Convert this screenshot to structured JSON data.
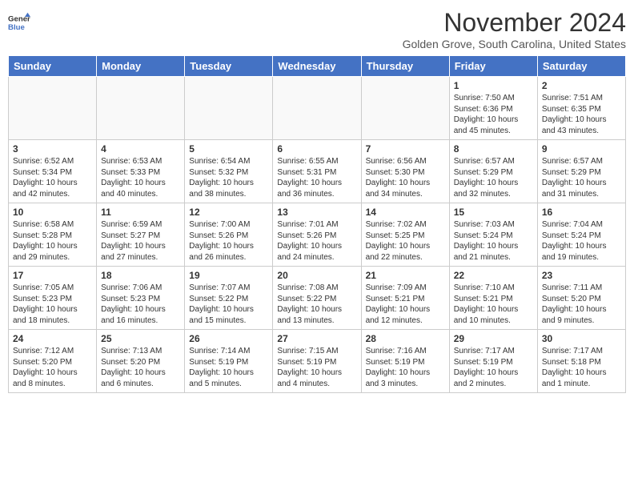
{
  "header": {
    "logo_line1": "General",
    "logo_line2": "Blue",
    "month": "November 2024",
    "location": "Golden Grove, South Carolina, United States"
  },
  "weekdays": [
    "Sunday",
    "Monday",
    "Tuesday",
    "Wednesday",
    "Thursday",
    "Friday",
    "Saturday"
  ],
  "weeks": [
    [
      {
        "day": "",
        "info": ""
      },
      {
        "day": "",
        "info": ""
      },
      {
        "day": "",
        "info": ""
      },
      {
        "day": "",
        "info": ""
      },
      {
        "day": "",
        "info": ""
      },
      {
        "day": "1",
        "info": "Sunrise: 7:50 AM\nSunset: 6:36 PM\nDaylight: 10 hours and 45 minutes."
      },
      {
        "day": "2",
        "info": "Sunrise: 7:51 AM\nSunset: 6:35 PM\nDaylight: 10 hours and 43 minutes."
      }
    ],
    [
      {
        "day": "3",
        "info": "Sunrise: 6:52 AM\nSunset: 5:34 PM\nDaylight: 10 hours and 42 minutes."
      },
      {
        "day": "4",
        "info": "Sunrise: 6:53 AM\nSunset: 5:33 PM\nDaylight: 10 hours and 40 minutes."
      },
      {
        "day": "5",
        "info": "Sunrise: 6:54 AM\nSunset: 5:32 PM\nDaylight: 10 hours and 38 minutes."
      },
      {
        "day": "6",
        "info": "Sunrise: 6:55 AM\nSunset: 5:31 PM\nDaylight: 10 hours and 36 minutes."
      },
      {
        "day": "7",
        "info": "Sunrise: 6:56 AM\nSunset: 5:30 PM\nDaylight: 10 hours and 34 minutes."
      },
      {
        "day": "8",
        "info": "Sunrise: 6:57 AM\nSunset: 5:29 PM\nDaylight: 10 hours and 32 minutes."
      },
      {
        "day": "9",
        "info": "Sunrise: 6:57 AM\nSunset: 5:29 PM\nDaylight: 10 hours and 31 minutes."
      }
    ],
    [
      {
        "day": "10",
        "info": "Sunrise: 6:58 AM\nSunset: 5:28 PM\nDaylight: 10 hours and 29 minutes."
      },
      {
        "day": "11",
        "info": "Sunrise: 6:59 AM\nSunset: 5:27 PM\nDaylight: 10 hours and 27 minutes."
      },
      {
        "day": "12",
        "info": "Sunrise: 7:00 AM\nSunset: 5:26 PM\nDaylight: 10 hours and 26 minutes."
      },
      {
        "day": "13",
        "info": "Sunrise: 7:01 AM\nSunset: 5:26 PM\nDaylight: 10 hours and 24 minutes."
      },
      {
        "day": "14",
        "info": "Sunrise: 7:02 AM\nSunset: 5:25 PM\nDaylight: 10 hours and 22 minutes."
      },
      {
        "day": "15",
        "info": "Sunrise: 7:03 AM\nSunset: 5:24 PM\nDaylight: 10 hours and 21 minutes."
      },
      {
        "day": "16",
        "info": "Sunrise: 7:04 AM\nSunset: 5:24 PM\nDaylight: 10 hours and 19 minutes."
      }
    ],
    [
      {
        "day": "17",
        "info": "Sunrise: 7:05 AM\nSunset: 5:23 PM\nDaylight: 10 hours and 18 minutes."
      },
      {
        "day": "18",
        "info": "Sunrise: 7:06 AM\nSunset: 5:23 PM\nDaylight: 10 hours and 16 minutes."
      },
      {
        "day": "19",
        "info": "Sunrise: 7:07 AM\nSunset: 5:22 PM\nDaylight: 10 hours and 15 minutes."
      },
      {
        "day": "20",
        "info": "Sunrise: 7:08 AM\nSunset: 5:22 PM\nDaylight: 10 hours and 13 minutes."
      },
      {
        "day": "21",
        "info": "Sunrise: 7:09 AM\nSunset: 5:21 PM\nDaylight: 10 hours and 12 minutes."
      },
      {
        "day": "22",
        "info": "Sunrise: 7:10 AM\nSunset: 5:21 PM\nDaylight: 10 hours and 10 minutes."
      },
      {
        "day": "23",
        "info": "Sunrise: 7:11 AM\nSunset: 5:20 PM\nDaylight: 10 hours and 9 minutes."
      }
    ],
    [
      {
        "day": "24",
        "info": "Sunrise: 7:12 AM\nSunset: 5:20 PM\nDaylight: 10 hours and 8 minutes."
      },
      {
        "day": "25",
        "info": "Sunrise: 7:13 AM\nSunset: 5:20 PM\nDaylight: 10 hours and 6 minutes."
      },
      {
        "day": "26",
        "info": "Sunrise: 7:14 AM\nSunset: 5:19 PM\nDaylight: 10 hours and 5 minutes."
      },
      {
        "day": "27",
        "info": "Sunrise: 7:15 AM\nSunset: 5:19 PM\nDaylight: 10 hours and 4 minutes."
      },
      {
        "day": "28",
        "info": "Sunrise: 7:16 AM\nSunset: 5:19 PM\nDaylight: 10 hours and 3 minutes."
      },
      {
        "day": "29",
        "info": "Sunrise: 7:17 AM\nSunset: 5:19 PM\nDaylight: 10 hours and 2 minutes."
      },
      {
        "day": "30",
        "info": "Sunrise: 7:17 AM\nSunset: 5:18 PM\nDaylight: 10 hours and 1 minute."
      }
    ]
  ]
}
